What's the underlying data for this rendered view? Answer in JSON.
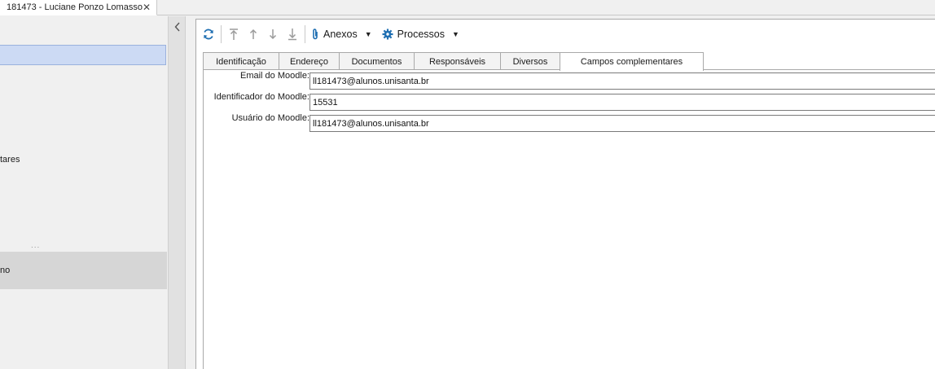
{
  "document_tab": {
    "title": "181473 - Luciane Ponzo Lomasso",
    "close_glyph": "✕"
  },
  "left_panel": {
    "partial_item_1": "tares",
    "ellipsis": "...",
    "partial_item_2": "no"
  },
  "toolbar": {
    "anexos_label": "Anexos",
    "processos_label": "Processos"
  },
  "tabs": [
    {
      "label": "Identificação"
    },
    {
      "label": "Endereço"
    },
    {
      "label": "Documentos"
    },
    {
      "label": "Responsáveis"
    },
    {
      "label": "Diversos"
    },
    {
      "label": "Campos complementares"
    }
  ],
  "active_tab": "Campos complementares",
  "fields": [
    {
      "label": "Email do Moodle:",
      "value": "ll181473@alunos.unisanta.br"
    },
    {
      "label": "Identificador do Moodle:",
      "value": "15531"
    },
    {
      "label": "Usuário do Moodle:",
      "value": "ll181473@alunos.unisanta.br"
    }
  ],
  "colors": {
    "icon_blue": "#1f6fb2",
    "icon_gray": "#9a9a9a",
    "selected_row": "#ccdaf4"
  }
}
